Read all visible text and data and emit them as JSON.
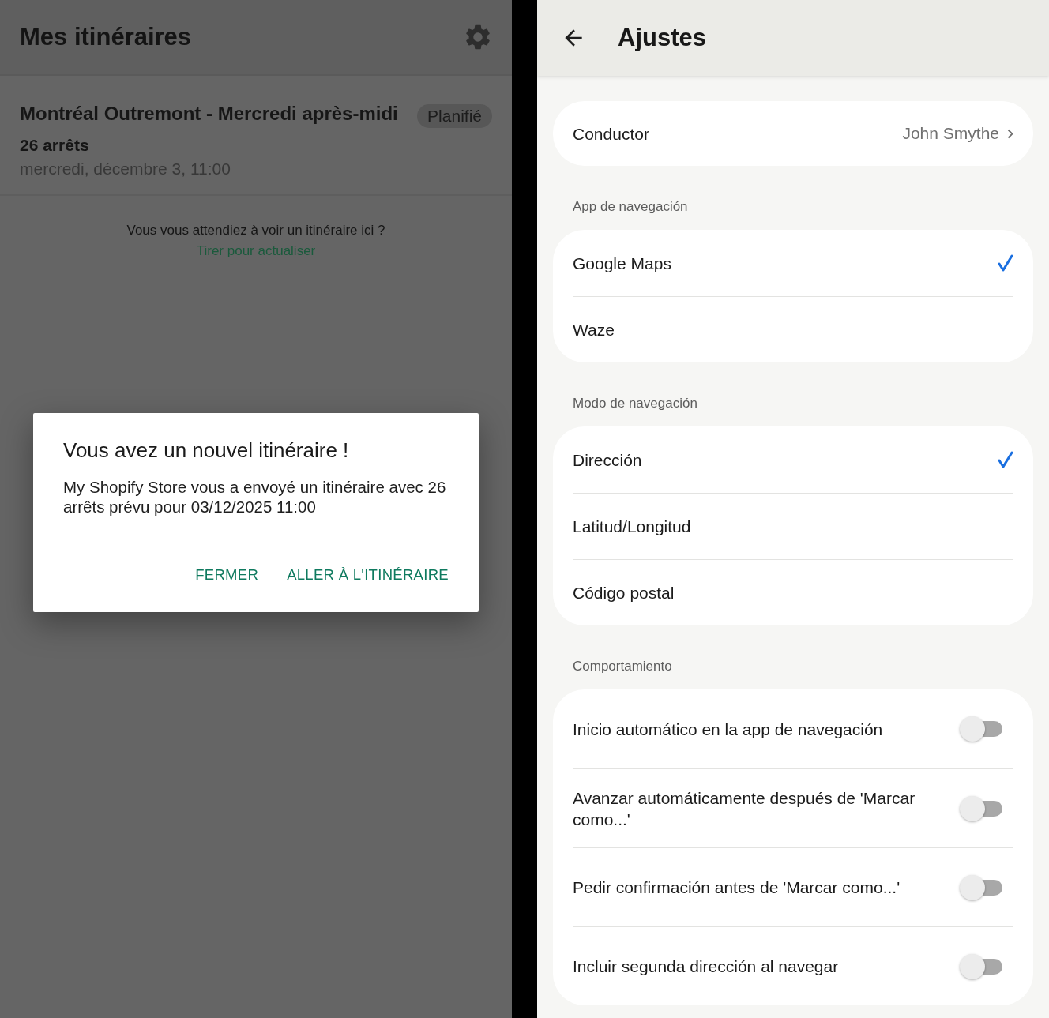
{
  "left": {
    "header": {
      "title": "Mes itinéraires"
    },
    "route": {
      "title": "Montréal Outremont - Mercredi après-midi",
      "badge": "Planifié",
      "stops": "26 arrêts",
      "date": "mercredi, décembre 3, 11:00"
    },
    "empty_hint": {
      "text": "Vous vous attendiez à voir un itinéraire ici ?",
      "link": "Tirer pour actualiser"
    },
    "dialog": {
      "title": "Vous avez un nouvel itinéraire !",
      "message": "My Shopify Store vous a envoyé un itinéraire avec 26 arrêts prévu pour 03/12/2025 11:00",
      "buttons": [
        "FERMER",
        "ALLER À L'ITINÉRAIRE"
      ]
    }
  },
  "right": {
    "header": {
      "title": "Ajustes"
    },
    "driver": {
      "label": "Conductor",
      "value": "John Smythe"
    },
    "sections": [
      {
        "heading": "App de navegación",
        "items": [
          {
            "kind": "choice",
            "label": "Google Maps",
            "selected": true
          },
          {
            "kind": "choice",
            "label": "Waze",
            "selected": false
          }
        ]
      },
      {
        "heading": "Modo de navegación",
        "items": [
          {
            "kind": "choice",
            "label": "Dirección",
            "selected": true
          },
          {
            "kind": "choice",
            "label": "Latitud/Longitud",
            "selected": false
          },
          {
            "kind": "choice",
            "label": "Código postal",
            "selected": false
          }
        ]
      },
      {
        "heading": "Comportamiento",
        "items": [
          {
            "kind": "toggle",
            "label": "Inicio automático en la app de navegación",
            "on": false
          },
          {
            "kind": "toggle",
            "label": "Avanzar automáticamente después de 'Marcar como...'",
            "on": false
          },
          {
            "kind": "toggle",
            "label": "Pedir confirmación antes de 'Marcar como...'",
            "on": false
          },
          {
            "kind": "toggle",
            "label": "Incluir segunda dirección al navegar",
            "on": false
          }
        ]
      }
    ]
  }
}
